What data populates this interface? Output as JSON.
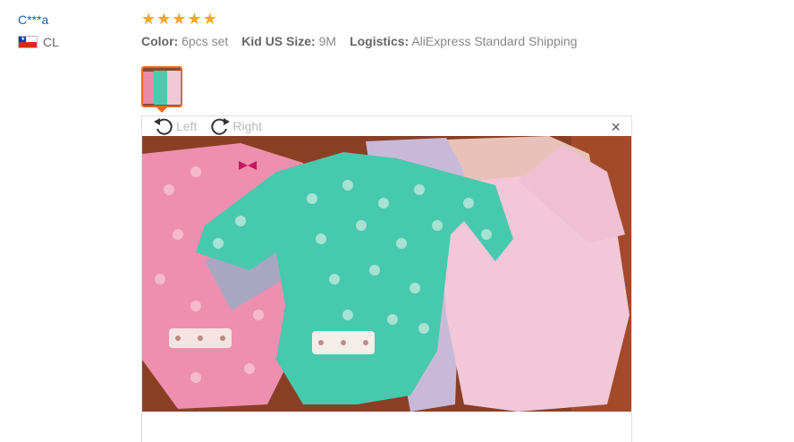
{
  "user": {
    "name": "C***a",
    "country": "CL"
  },
  "review": {
    "rating": 5,
    "color_label": "Color:",
    "color_value": "6pcs set",
    "size_label": "Kid US Size:",
    "size_value": "9M",
    "logistics_label": "Logistics:",
    "logistics_value": "AliExpress Standard Shipping"
  },
  "viewer": {
    "rotate_left_label": "Left",
    "rotate_right_label": "Right",
    "close_label": "×"
  },
  "colors": {
    "accent": "#e56b1f",
    "star": "#f5a623",
    "link": "#1a5fb4"
  }
}
